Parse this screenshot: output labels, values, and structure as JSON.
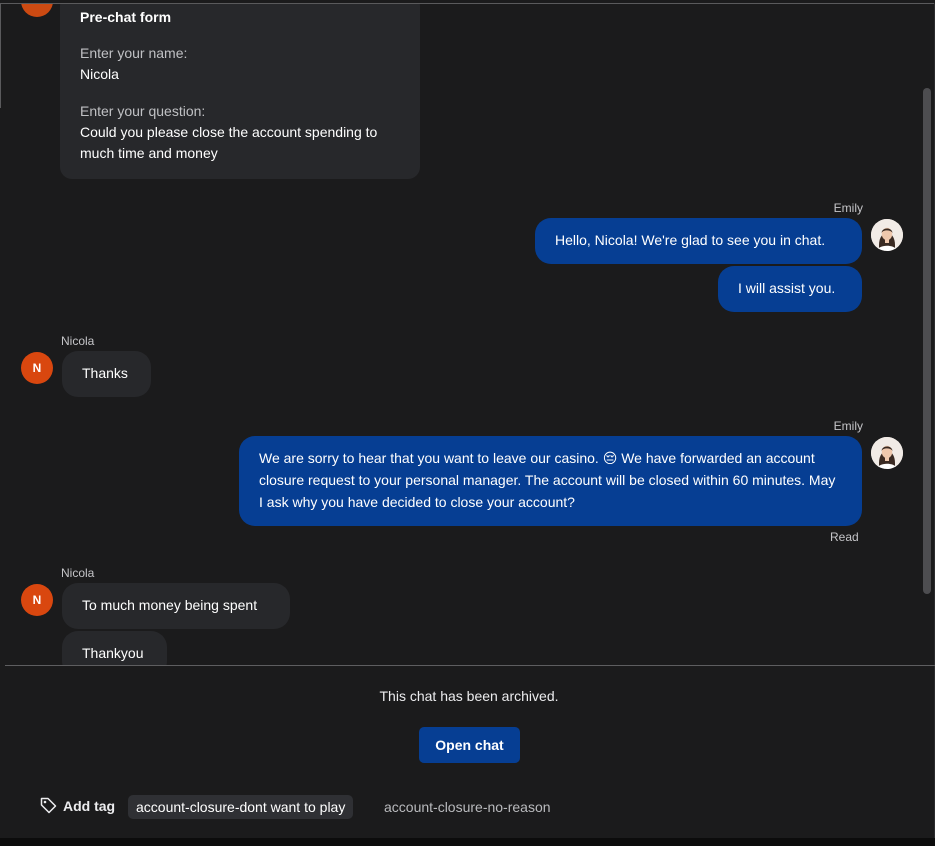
{
  "prechat": {
    "title": "Pre-chat form",
    "name_label": "Enter your name:",
    "name_value": "Nicola",
    "question_label": "Enter your question:",
    "question_value": "Could you please close the account spending to much time and money"
  },
  "agent": {
    "name": "Emily"
  },
  "customer": {
    "name": "Nicola",
    "initial": "N"
  },
  "messages": {
    "m1": "Hello, Nicola! We're glad to see you in chat.",
    "m2": "I will assist you.",
    "m3": "Thanks",
    "m4_text": "We are sorry to hear that you want to leave our casino.",
    "m4_emoji": "😔",
    "m4_rest": "We have forwarded an account closure request to your personal manager. The account will be closed within 60 minutes. May I ask why you have decided to close your account?",
    "m4_status": "Read",
    "m5": "To much money being spent",
    "m6": "Thankyou"
  },
  "footer": {
    "archived_notice": "This chat has been archived.",
    "open_chat_label": "Open chat",
    "add_tag_label": "Add tag",
    "tags": [
      "account-closure-dont want to play",
      "account-closure-no-reason"
    ]
  },
  "colors": {
    "background": "#1b1b1c",
    "agent_bubble": "#063e93",
    "customer_bubble": "#27282b",
    "customer_avatar": "#d9470f"
  }
}
